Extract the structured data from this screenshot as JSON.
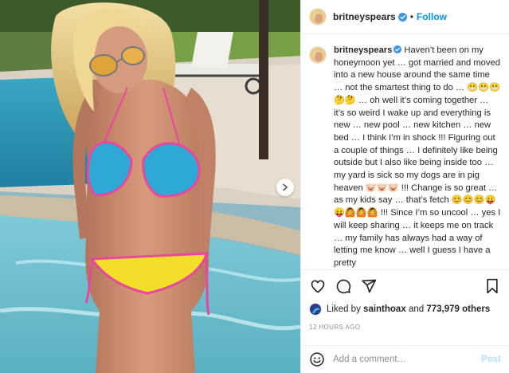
{
  "header": {
    "username": "britneyspears",
    "separator": "•",
    "follow_label": "Follow"
  },
  "caption": {
    "username": "britneyspears",
    "text": "Haven’t been on my honeymoon yet … got married and moved into a new house around the same time … not the smartest thing to do … 😬😬😬🤔🤔 … oh well it’s coming together … it’s so weird I wake up and everything is new … new pool … new kitchen … new bed … I think I’m in shock !!! Figuring out a couple of things … I definitely like being outside but I also like being inside too … my yard is sick so my dogs are in pig heaven 🐷🐷🐷 !!! Change is so great … as my kids say … that’s fetch 😊😊😊😛😛🙆🙆🙆 !!! Since I’m so uncool … yes I will keep sharing … it keeps me on track … my family has always had a way of letting me know … well I guess I have a pretty"
  },
  "likes": {
    "prefix": "Liked by",
    "user": "sainthoax",
    "conjunction": "and",
    "others": "773,979 others"
  },
  "timestamp": "12 HOURS AGO",
  "comment_box": {
    "placeholder": "Add a comment…",
    "post_label": "Post"
  },
  "icons": {
    "like": "heart-icon",
    "comment": "comment-icon",
    "share": "share-icon",
    "save": "bookmark-icon",
    "emoji": "smiley-icon",
    "carousel": "chevron-right-icon",
    "verified": "verified-badge-icon"
  },
  "colors": {
    "accent": "#0095f6",
    "verified": "#3897f0",
    "post_disabled": "#b2dffc",
    "muted": "#8e8e8e"
  }
}
